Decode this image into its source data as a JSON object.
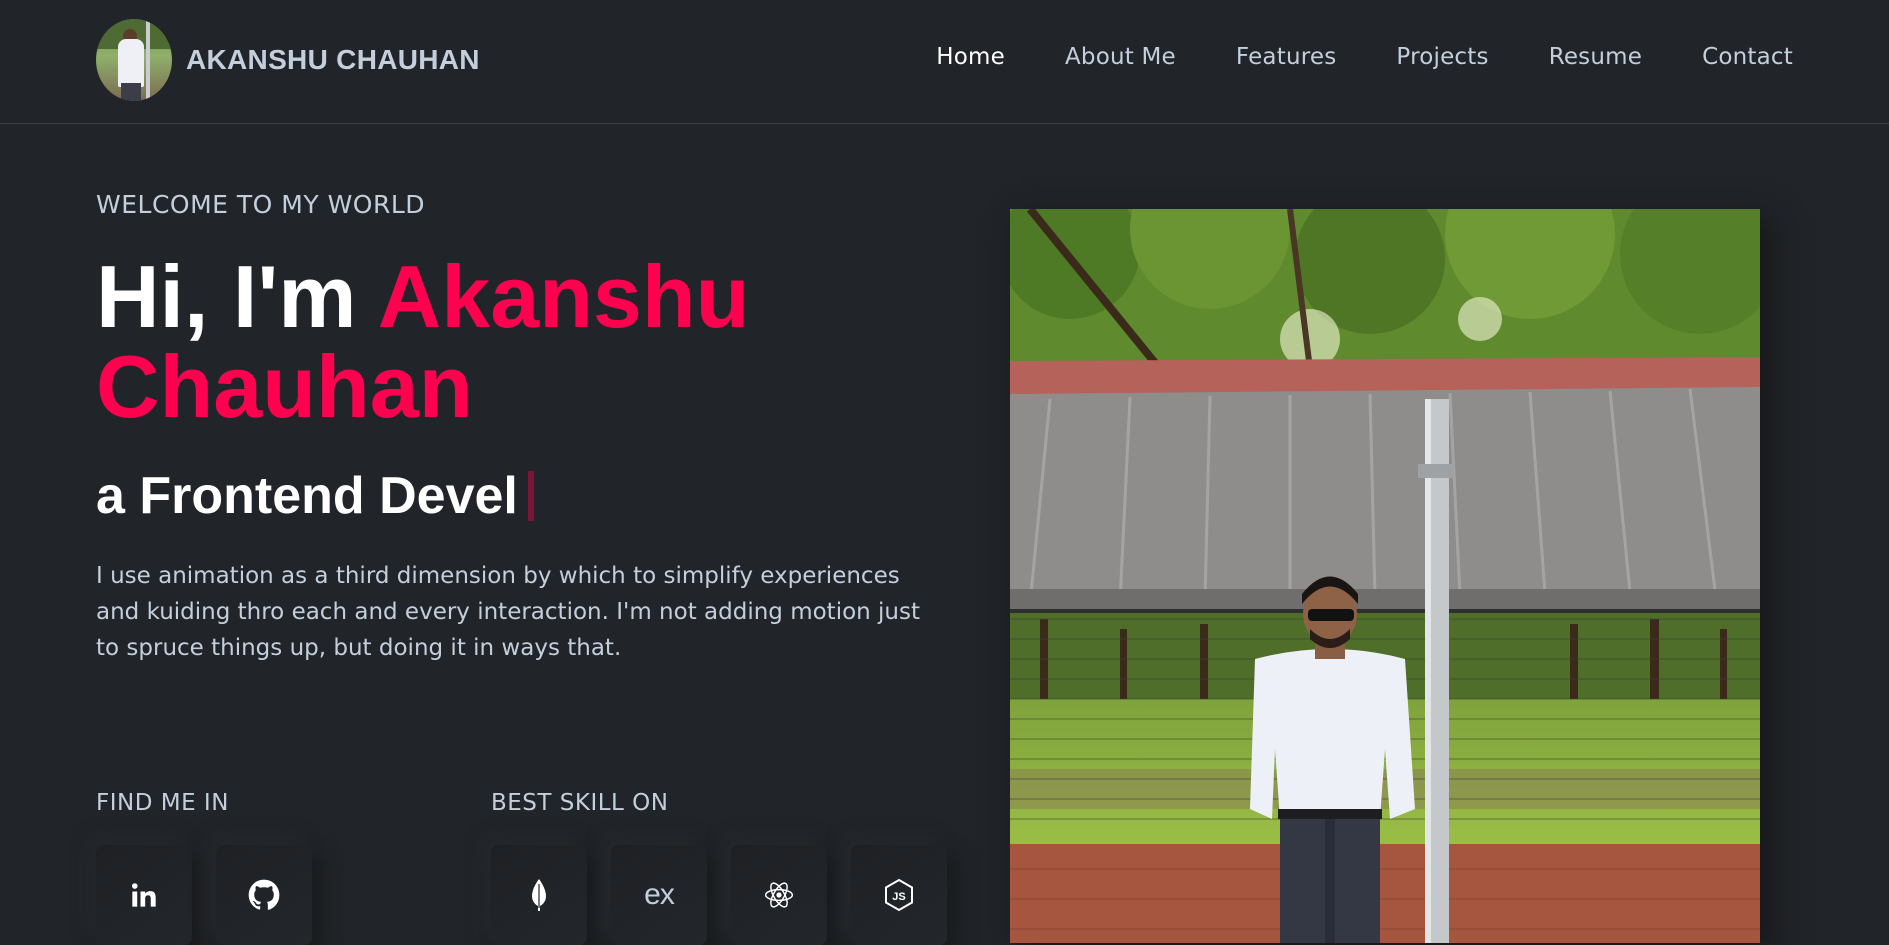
{
  "brand": {
    "name": "AKANSHU CHAUHAN"
  },
  "nav": {
    "items": [
      {
        "label": "Home",
        "active": true
      },
      {
        "label": "About Me"
      },
      {
        "label": "Features"
      },
      {
        "label": "Projects"
      },
      {
        "label": "Resume"
      },
      {
        "label": "Contact"
      }
    ]
  },
  "hero": {
    "welcome": "WELCOME TO MY WORLD",
    "greeting": "Hi, I'm ",
    "name": "Akanshu Chauhan",
    "typed_text": "a Frontend Devel",
    "description": "I use animation as a third dimension by which to simplify experiences and kuiding thro each and every interaction. I'm not adding motion just to spruce things up, but doing it in ways that."
  },
  "social": {
    "label": "FIND ME IN",
    "icons": [
      "linkedin-icon",
      "github-icon"
    ]
  },
  "skills": {
    "label": "BEST SKILL ON",
    "icons": [
      "mongodb-icon",
      "express-icon",
      "react-icon",
      "nodejs-icon"
    ],
    "express_text": "ex"
  },
  "colors": {
    "background": "#212428",
    "accent": "#ff014f",
    "text": "#c4cfde",
    "heading": "#ffffff"
  }
}
